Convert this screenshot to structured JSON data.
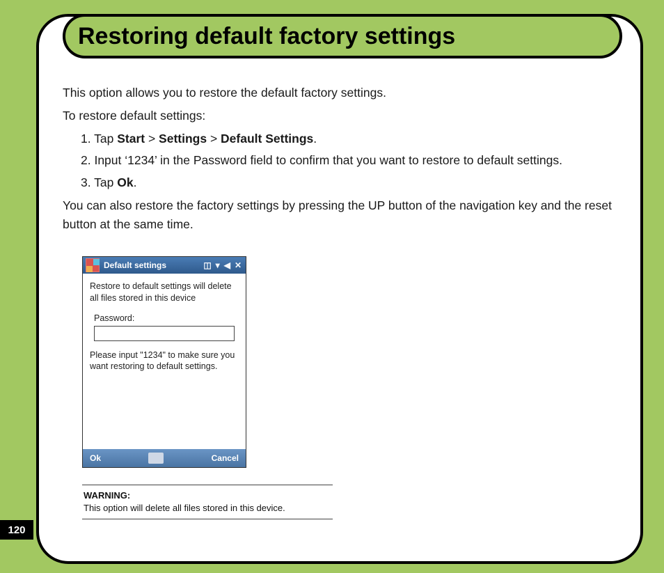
{
  "page": {
    "number": "120",
    "title": "Restoring default factory settings"
  },
  "body": {
    "intro": "This option allows you to restore the default factory settings.",
    "lead": "To restore default settings:",
    "steps": {
      "s1_pre": "1. Tap ",
      "s1_a": "Start",
      "s1_sep1": " > ",
      "s1_b": "Settings",
      "s1_sep2": " > ",
      "s1_c": "Default Settings",
      "s1_post": ".",
      "s2": "2. Input ‘1234’ in the Password field to confirm that you want to restore to default settings.",
      "s3_pre": "3. Tap ",
      "s3_a": "Ok",
      "s3_post": "."
    },
    "outro": "You can also restore the factory settings by pressing the UP button of the navigation key and the reset button at the same time."
  },
  "device": {
    "title": "Default settings",
    "icons": {
      "bt": "◫",
      "signal": "▾",
      "volume": "◀",
      "close": "✕"
    },
    "line1": "Restore to default settings will delete all files stored in this device",
    "password_label": "Password:",
    "hint": "Please input \"1234\" to make sure you want restoring to default settings.",
    "ok": "Ok",
    "cancel": "Cancel"
  },
  "warning": {
    "label": "WARNING:",
    "text": "This option will delete all files stored in this device."
  }
}
